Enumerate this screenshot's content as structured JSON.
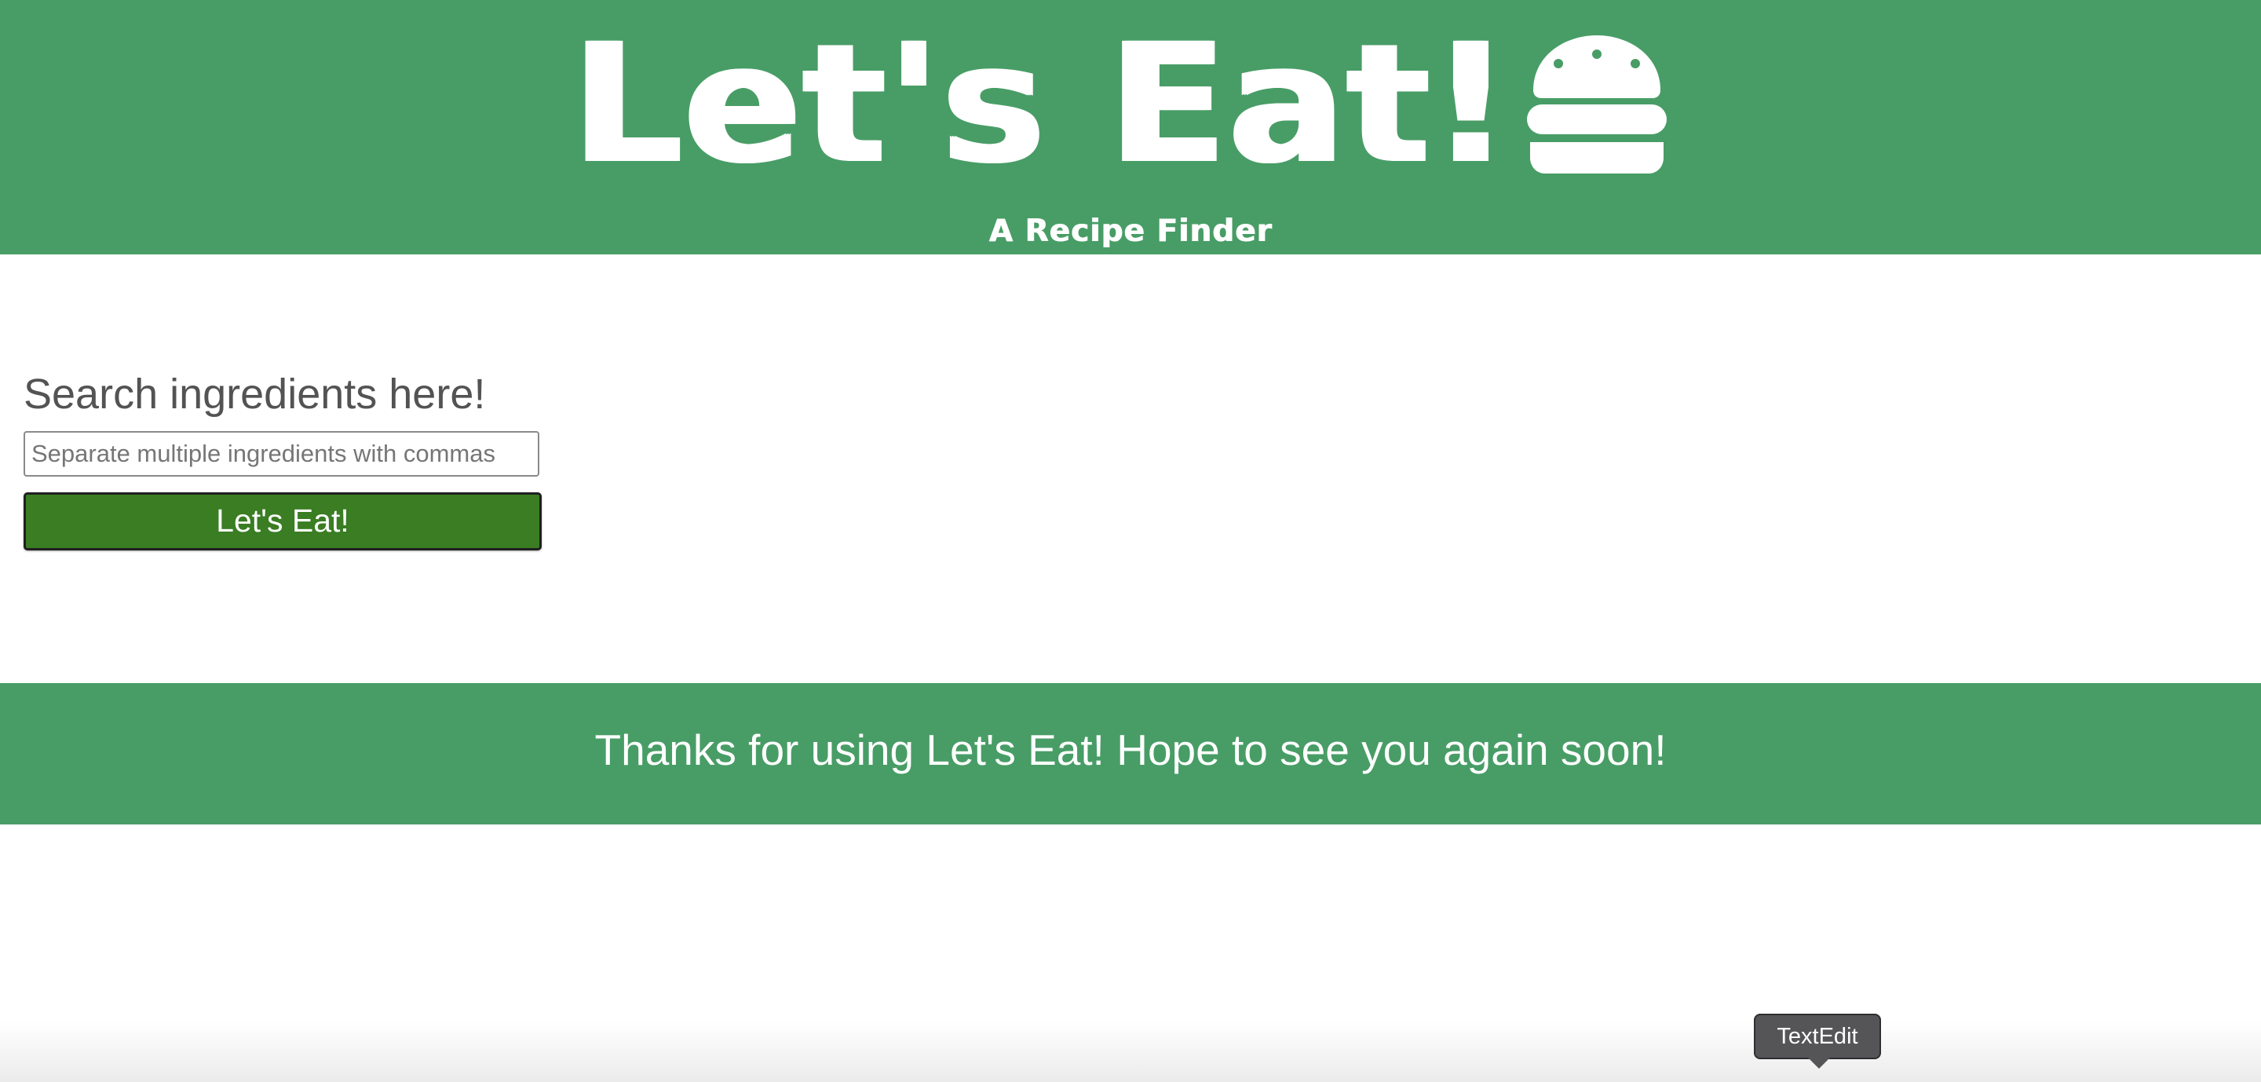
{
  "header": {
    "title": "Let's Eat!",
    "subtitle": "A Recipe Finder",
    "icon": "hamburger-icon",
    "background_color": "#489d66"
  },
  "search": {
    "heading": "Search ingredients here!",
    "placeholder": "Separate multiple ingredients with commas",
    "value": "",
    "button_label": "Let's Eat!",
    "button_color": "#3a7d23"
  },
  "footer": {
    "message": "Thanks for using Let's Eat! Hope to see you again soon!",
    "background_color": "#489d66"
  },
  "tooltip": {
    "label": "TextEdit"
  }
}
